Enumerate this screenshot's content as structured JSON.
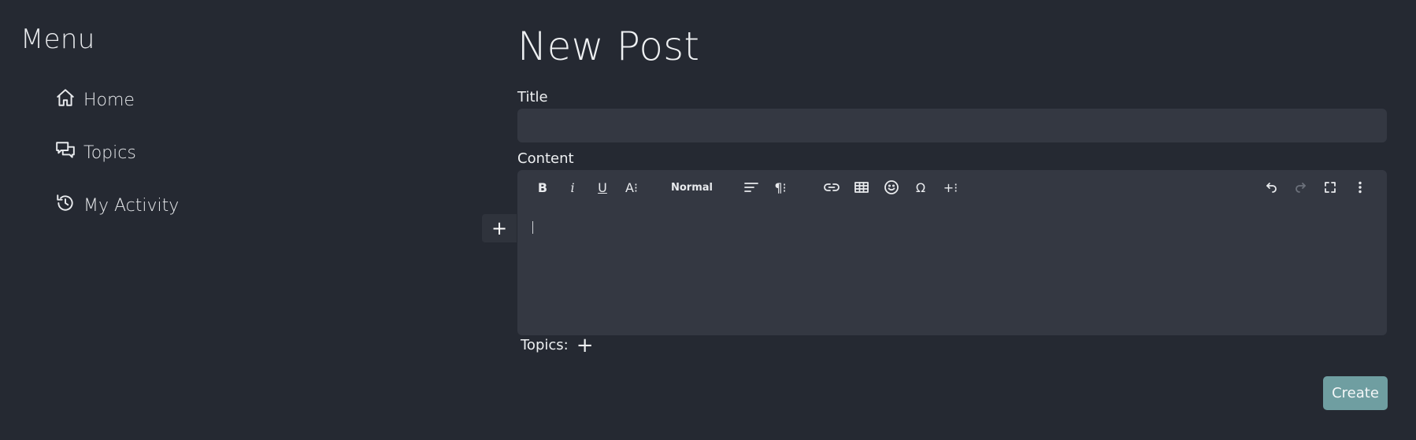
{
  "sidebar": {
    "title": "Menu",
    "items": [
      {
        "label": "Home",
        "icon": "home-icon"
      },
      {
        "label": "Topics",
        "icon": "chat-bubbles-icon"
      },
      {
        "label": "My Activity",
        "icon": "history-icon"
      }
    ]
  },
  "main": {
    "page_title": "New Post",
    "title_label": "Title",
    "title_value": "",
    "content_label": "Content",
    "editor": {
      "toolbar": {
        "bold": "B",
        "italic": "i",
        "underline": "U",
        "font_size": "A⁝",
        "paragraph_style": "Normal",
        "paragraph": "¶⁝",
        "special_char": "Ω",
        "insert_more": "+⁝"
      },
      "content": ""
    },
    "block_add": "+",
    "topics_label": "Topics:",
    "topics_add": "+",
    "create_label": "Create"
  },
  "colors": {
    "background": "#252932",
    "surface": "#343842",
    "accent": "#6f9ea1"
  }
}
